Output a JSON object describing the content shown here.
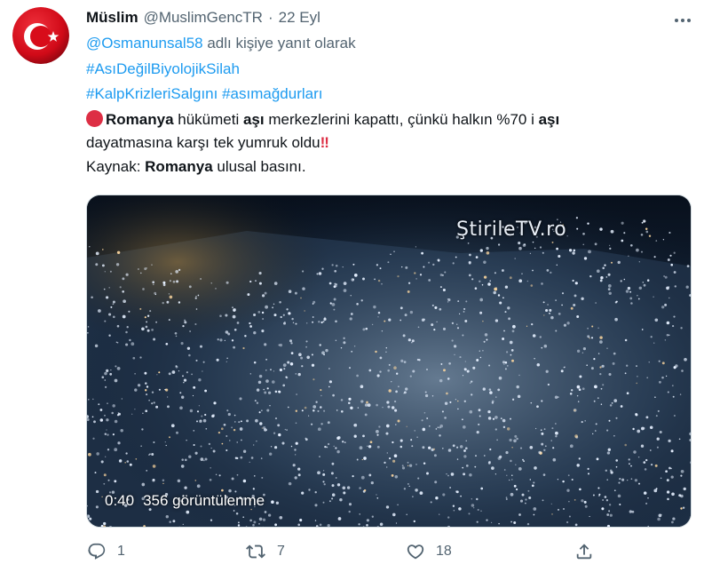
{
  "author": {
    "name": "Müslim",
    "handle": "@MuslimGencTR",
    "separator": "·",
    "time": "22 Eyl"
  },
  "reply": {
    "mention": "@Osmanunsal58",
    "suffix": " adlı kişiye yanıt olarak"
  },
  "hashtags": {
    "line1": "#AsıDeğilBiyolojikSilah",
    "line2a": "#KalpKrizleriSalgını",
    "line2b": "#asımağdurları"
  },
  "body": {
    "l1_b1": "Romanya",
    "l1_t1": " hükümeti ",
    "l1_b2": "aşı",
    "l1_t2": " merkezlerini kapattı,  çünkü halkın %70 i ",
    "l1_b3": "aşı",
    "l2_t1": "dayatmasına karşı tek yumruk oldu",
    "l2_emoji": "‼",
    "l3_t1": "Kaynak: ",
    "l3_b1": "Romanya",
    "l3_t2": " ulusal basını."
  },
  "media": {
    "watermark": "ŞtirileTV.ro",
    "duration": "0:40",
    "views": "356 görüntülenme"
  },
  "actions": {
    "replies": "1",
    "retweets": "7",
    "likes": "18"
  },
  "icons": {
    "more": "more-icon",
    "reply": "reply-icon",
    "retweet": "retweet-icon",
    "like": "heart-icon",
    "share": "share-icon"
  },
  "colors": {
    "link": "#1d9bf0",
    "muted": "#536471",
    "flag_red": "#e30a17",
    "emoji_red": "#dd2e44"
  }
}
